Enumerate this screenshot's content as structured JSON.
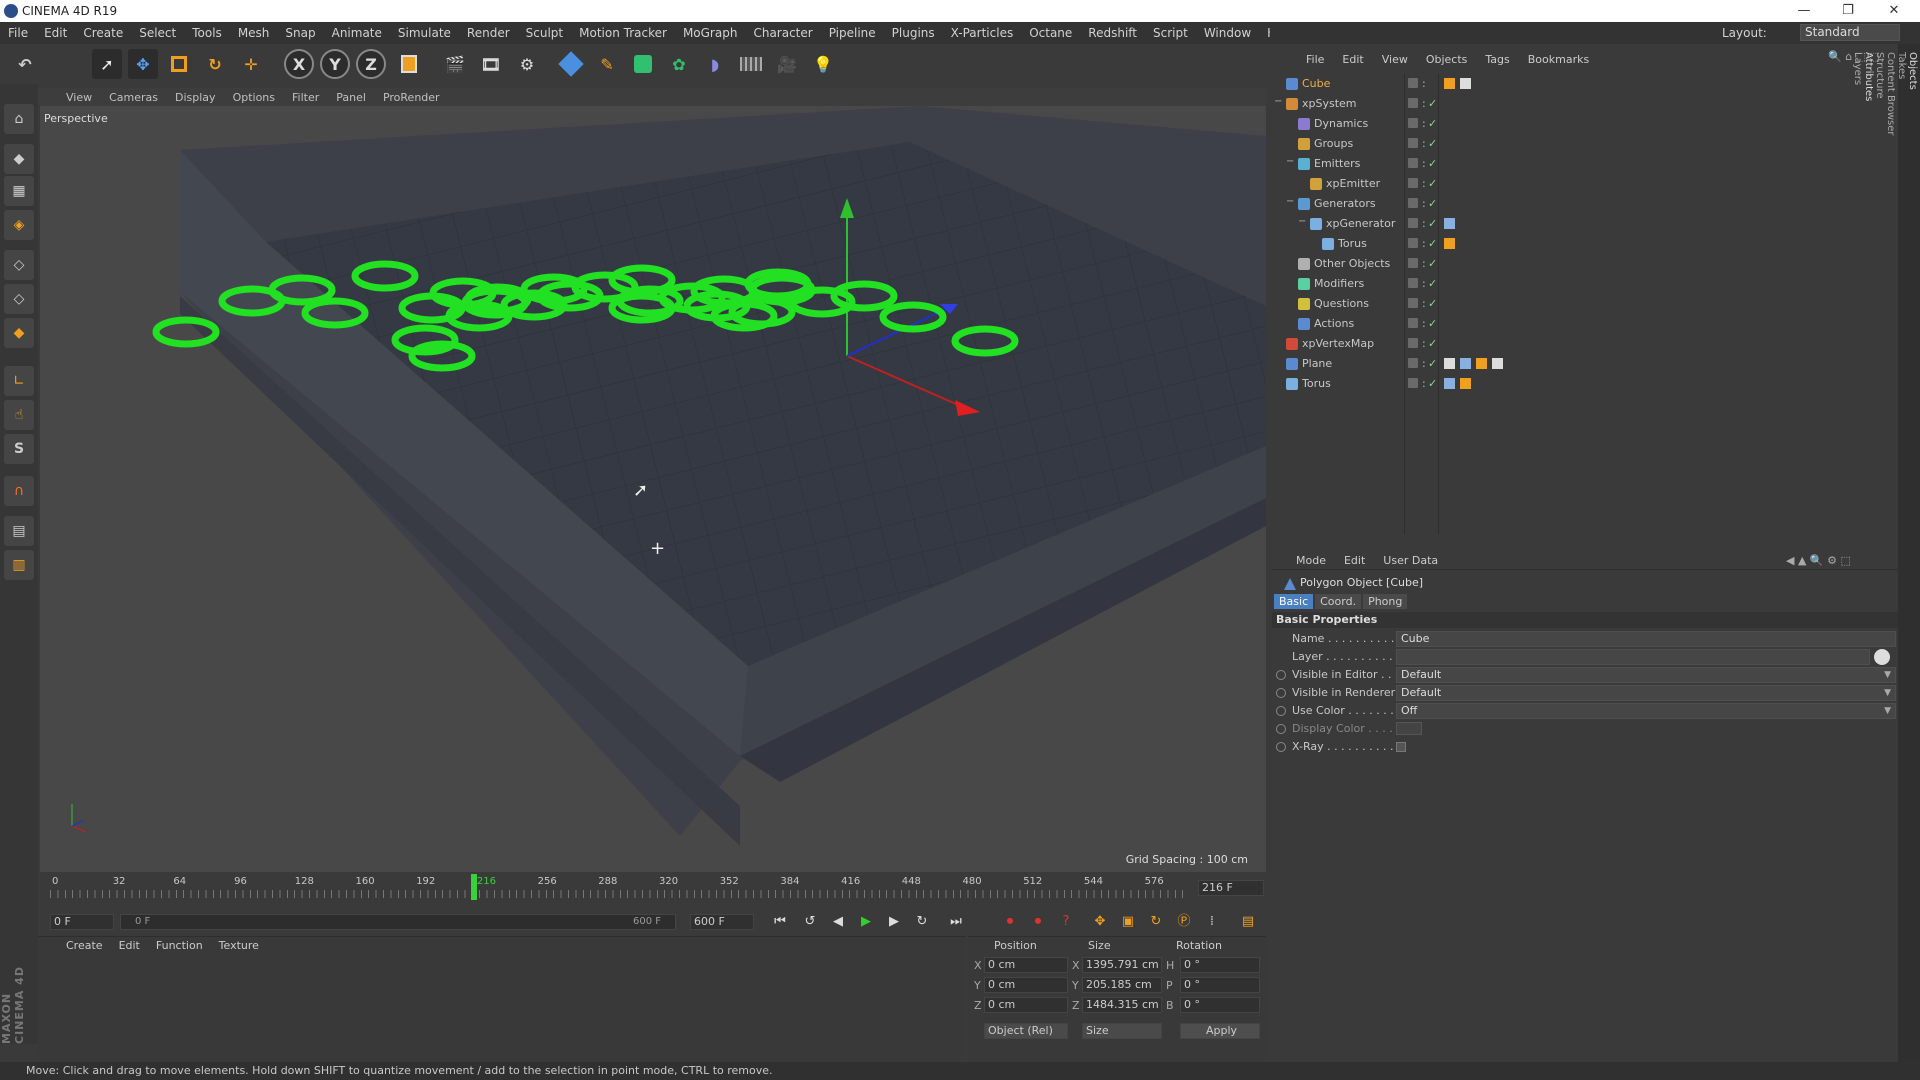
{
  "window": {
    "title": "CINEMA 4D R19"
  },
  "menubar": [
    "File",
    "Edit",
    "Create",
    "Select",
    "Tools",
    "Mesh",
    "Snap",
    "Animate",
    "Simulate",
    "Render",
    "Sculpt",
    "Motion Tracker",
    "MoGraph",
    "Character",
    "Pipeline",
    "Plugins",
    "X-Particles",
    "Octane",
    "Redshift",
    "Script",
    "Window",
    "Help"
  ],
  "layout": {
    "label": "Layout:",
    "value": "Standard"
  },
  "toolbar_icons": [
    "undo-icon",
    "live-selection-icon",
    "move-icon",
    "scale-icon",
    "rotate-icon",
    "move-mixed-icon",
    "x-axis-icon",
    "y-axis-icon",
    "z-axis-icon",
    "coordinate-system-icon",
    "render-view-icon",
    "render-picture-viewer-icon",
    "render-settings-icon",
    "cube-primitive-icon",
    "pen-spline-icon",
    "subdivision-icon",
    "array-icon",
    "deformer-icon",
    "floor-icon",
    "camera-icon",
    "light-icon"
  ],
  "axis_labels": {
    "x": "X",
    "y": "Y",
    "z": "Z"
  },
  "viewport": {
    "menu": [
      "View",
      "Cameras",
      "Display",
      "Options",
      "Filter",
      "Panel",
      "ProRender"
    ],
    "label": "Perspective",
    "grid_spacing": "Grid Spacing : 100 cm"
  },
  "timeline": {
    "ticks": [
      "0",
      "32",
      "64",
      "96",
      "128",
      "160",
      "192",
      "216",
      "256",
      "288",
      "320",
      "352",
      "384",
      "416",
      "448",
      "480",
      "512",
      "544",
      "576"
    ],
    "current_frame_field": "216 F",
    "start": "0 F",
    "range_start": "0 F",
    "range_end": "600 F",
    "end": "600 F",
    "current_frame": 216,
    "max_frame": 600
  },
  "materials": {
    "menu": [
      "Create",
      "Edit",
      "Function",
      "Texture"
    ]
  },
  "coords": {
    "headers": {
      "position": "Position",
      "size": "Size",
      "rotation": "Rotation"
    },
    "rows": [
      {
        "axis": "X",
        "pos": "0 cm",
        "size_axis": "X",
        "size": "1395.791 cm",
        "rot_axis": "H",
        "rot": "0 °"
      },
      {
        "axis": "Y",
        "pos": "0 cm",
        "size_axis": "Y",
        "size": "205.185 cm",
        "rot_axis": "P",
        "rot": "0 °"
      },
      {
        "axis": "Z",
        "pos": "0 cm",
        "size_axis": "Z",
        "size": "1484.315 cm",
        "rot_axis": "B",
        "rot": "0 °"
      }
    ],
    "mode": "Object (Rel)",
    "size_mode": "Size",
    "apply": "Apply"
  },
  "objects": {
    "menu": [
      "File",
      "Edit",
      "View",
      "Objects",
      "Tags",
      "Bookmarks"
    ],
    "items": [
      {
        "name": "Cube",
        "depth": 0,
        "color": "#5a8ad0",
        "selected": true
      },
      {
        "name": "xpSystem",
        "depth": 0,
        "color": "#d08a3a",
        "expander": "−"
      },
      {
        "name": "Dynamics",
        "depth": 1,
        "color": "#8a7ad0"
      },
      {
        "name": "Groups",
        "depth": 1,
        "color": "#d0a03a"
      },
      {
        "name": "Emitters",
        "depth": 1,
        "color": "#5ab0d0",
        "expander": "−"
      },
      {
        "name": "xpEmitter",
        "depth": 2,
        "color": "#d0a03a"
      },
      {
        "name": "Generators",
        "depth": 1,
        "color": "#5a9ad0",
        "expander": "−"
      },
      {
        "name": "xpGenerator",
        "depth": 2,
        "color": "#7ab0e0",
        "expander": "−"
      },
      {
        "name": "Torus",
        "depth": 3,
        "color": "#7ab0e0"
      },
      {
        "name": "Other Objects",
        "depth": 1,
        "color": "#b0b0b0"
      },
      {
        "name": "Modifiers",
        "depth": 1,
        "color": "#5ad0a0"
      },
      {
        "name": "Questions",
        "depth": 1,
        "color": "#d0c03a"
      },
      {
        "name": "Actions",
        "depth": 1,
        "color": "#5a8ad0"
      },
      {
        "name": "xpVertexMap",
        "depth": 0,
        "color": "#d04a3a"
      },
      {
        "name": "Plane",
        "depth": 0,
        "color": "#5a8ad0"
      },
      {
        "name": "Torus",
        "depth": 0,
        "color": "#7ab0e0"
      }
    ]
  },
  "attributes": {
    "menu": [
      "Mode",
      "Edit",
      "User Data"
    ],
    "object_title": "Polygon Object [Cube]",
    "tabs": [
      "Basic",
      "Coord.",
      "Phong"
    ],
    "section": "Basic Properties",
    "fields": [
      {
        "label": "Name . . . . . . . . . . . .",
        "value": "Cube"
      },
      {
        "label": "Layer . . . . . . . . . . . .",
        "value": ""
      },
      {
        "label": "Visible in Editor . . .",
        "value": "Default"
      },
      {
        "label": "Visible in Renderer",
        "value": "Default"
      },
      {
        "label": "Use Color . . . . . . . .",
        "value": "Off"
      },
      {
        "label": "Display Color . . . .",
        "value": ""
      },
      {
        "label": "X-Ray . . . . . . . . . . .",
        "value": ""
      }
    ]
  },
  "right_edge_tabs": [
    "Objects",
    "Takes",
    "Content Browser",
    "Structure",
    "Attributes",
    "Layers"
  ],
  "brand": "MAXON CINEMA 4D",
  "status": "Move: Click and drag to move elements. Hold down SHIFT to quantize movement / add to the selection in point mode, CTRL to remove.",
  "colors": {
    "accent_blue": "#4a7fc0",
    "torus_green": "#22e022",
    "highlight_orange": "#e0a040"
  }
}
